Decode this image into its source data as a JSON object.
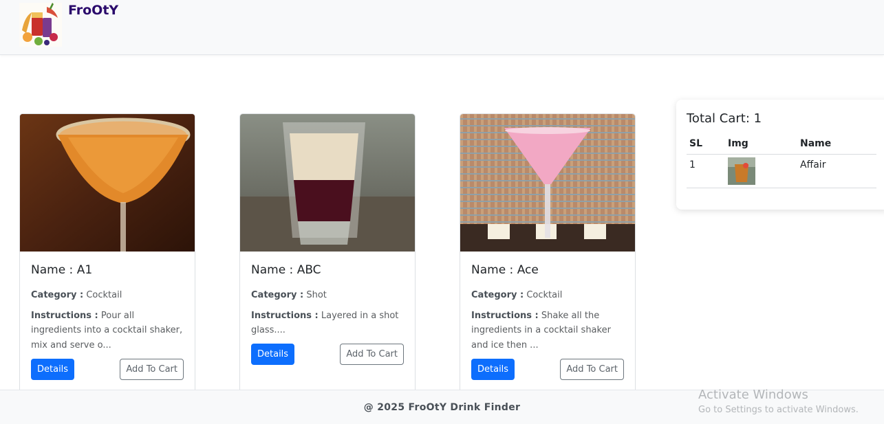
{
  "header": {
    "brand": "FroOtY",
    "logo_icon": "juice-splash-logo-icon"
  },
  "cards": [
    {
      "name_label": "Name : A1",
      "category_key": "Category :",
      "category_value": "Cocktail",
      "instructions_key": "Instructions :",
      "instructions_value": "Pour all ingredients into a cocktail shaker, mix and serve o...",
      "details_label": "Details",
      "add_to_cart_label": "Add To Cart",
      "image_icon": "orange-martini-photo"
    },
    {
      "name_label": "Name : ABC",
      "category_key": "Category :",
      "category_value": "Shot",
      "instructions_key": "Instructions :",
      "instructions_value": "Layered in a shot glass....",
      "details_label": "Details",
      "add_to_cart_label": "Add To Cart",
      "image_icon": "layered-shot-photo"
    },
    {
      "name_label": "Name : Ace",
      "category_key": "Category :",
      "category_value": "Cocktail",
      "instructions_key": "Instructions :",
      "instructions_value": "Shake all the ingredients in a cocktail shaker and ice then ...",
      "details_label": "Details",
      "add_to_cart_label": "Add To Cart",
      "image_icon": "pink-martini-photo"
    }
  ],
  "cart": {
    "title": "Total Cart: 1",
    "columns": [
      "SL",
      "Img",
      "Name"
    ],
    "rows": [
      {
        "sl": "1",
        "name": "Affair",
        "img_icon": "drink-thumbnail"
      }
    ]
  },
  "footer": {
    "text": "@ 2025 FroOtY Drink Finder"
  },
  "watermark": {
    "title": "Activate Windows",
    "subtitle": "Go to Settings to activate Windows."
  },
  "colors": {
    "primary": "#0d6efd",
    "brand": "#2a0a6b",
    "header_bg": "#f8f9fa"
  }
}
